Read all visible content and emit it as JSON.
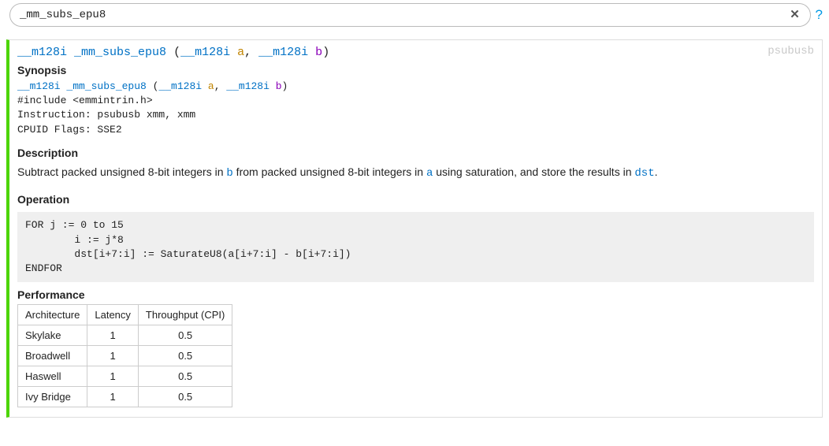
{
  "search": {
    "value": "_mm_subs_epu8",
    "help": "?"
  },
  "result": {
    "signature": {
      "ret": "__m128i",
      "name": "_mm_subs_epu8",
      "open": " (",
      "p1type": "__m128i",
      "p1name": "a",
      "sep": ", ",
      "p2type": "__m128i",
      "p2name": "b",
      "close": ")"
    },
    "instr": "psubusb",
    "synopsis": {
      "heading": "Synopsis",
      "include": "#include <emmintrin.h>",
      "instruction": "Instruction: psubusb xmm, xmm",
      "cpuid": "CPUID Flags: SSE2"
    },
    "description": {
      "heading": "Description",
      "t1": "Subtract packed unsigned 8-bit integers in ",
      "c1": "b",
      "t2": " from packed unsigned 8-bit integers in ",
      "c2": "a",
      "t3": " using saturation, and store the results in ",
      "c3": "dst",
      "t4": "."
    },
    "operation": {
      "heading": "Operation",
      "code": "FOR j := 0 to 15\n        i := j*8\n        dst[i+7:i] := SaturateU8(a[i+7:i] - b[i+7:i])\nENDFOR"
    },
    "performance": {
      "heading": "Performance",
      "cols": [
        "Architecture",
        "Latency",
        "Throughput (CPI)"
      ],
      "rows": [
        {
          "arch": "Skylake",
          "latency": "1",
          "throughput": "0.5"
        },
        {
          "arch": "Broadwell",
          "latency": "1",
          "throughput": "0.5"
        },
        {
          "arch": "Haswell",
          "latency": "1",
          "throughput": "0.5"
        },
        {
          "arch": "Ivy Bridge",
          "latency": "1",
          "throughput": "0.5"
        }
      ]
    }
  }
}
